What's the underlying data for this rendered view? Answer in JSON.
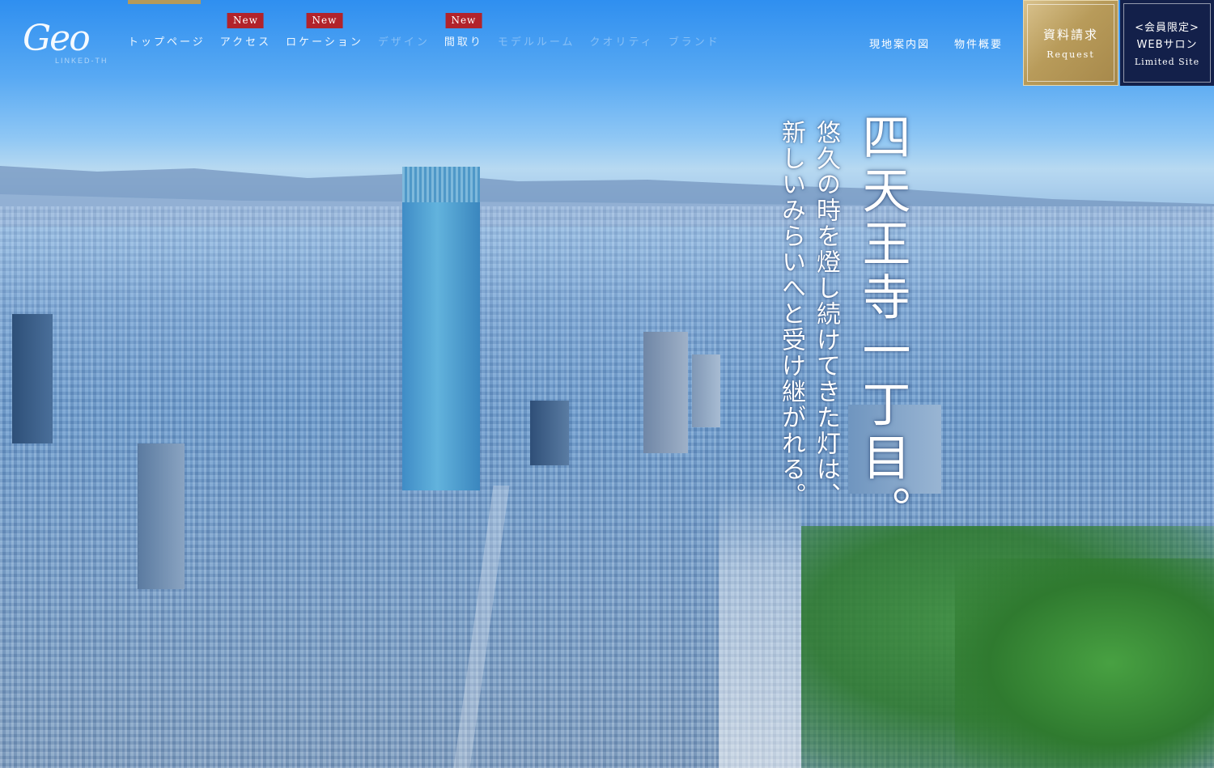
{
  "brand": {
    "logo_word": "Geo",
    "logo_sub": "LINKED-TH"
  },
  "nav": {
    "items": [
      {
        "label": "トップページ",
        "new": false,
        "dim": false
      },
      {
        "label": "アクセス",
        "new": true,
        "dim": false
      },
      {
        "label": "ロケーション",
        "new": true,
        "dim": false
      },
      {
        "label": "デザイン",
        "new": false,
        "dim": true
      },
      {
        "label": "間取り",
        "new": true,
        "dim": false
      },
      {
        "label": "モデルルーム",
        "new": false,
        "dim": true
      },
      {
        "label": "クオリティ",
        "new": false,
        "dim": true
      },
      {
        "label": "ブランド",
        "new": false,
        "dim": true
      }
    ],
    "new_badge": "New"
  },
  "sub_links": {
    "map": "現地案内図",
    "outline": "物件概要"
  },
  "request_button": {
    "jp": "資料請求",
    "en": "Request"
  },
  "salon_button": {
    "line1": "<会員限定>",
    "line2": "WEBサロン",
    "line3": "Limited Site"
  },
  "hero": {
    "title": "四天王寺一丁目。",
    "copy_line1": "悠久の時を燈し続けてきた灯は、",
    "copy_line2": "新しいみらいへと受け継がれる。"
  },
  "colors": {
    "gold": "#b69a5a",
    "navy": "#13204a",
    "new_red": "#b2232b"
  }
}
